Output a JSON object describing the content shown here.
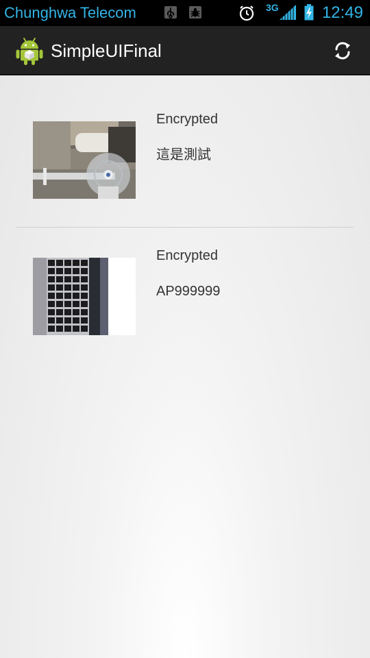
{
  "status_bar": {
    "carrier": "Chunghwa Telecom",
    "network_type": "3G",
    "time": "12:49",
    "icons": [
      "usb-icon",
      "bug-icon",
      "alarm-icon",
      "signal-icon",
      "battery-charging-icon"
    ]
  },
  "action_bar": {
    "title": "SimpleUIFinal",
    "app_icon": "android-icon",
    "refresh_icon": "refresh-icon"
  },
  "list": {
    "items": [
      {
        "status": "Encrypted",
        "text": "這是測試",
        "thumbnail": "photo-fan-room"
      },
      {
        "status": "Encrypted",
        "text": "AP999999",
        "thumbnail": "photo-laptop-keyboard"
      }
    ]
  },
  "colors": {
    "status_bar_text": "#33b5e5",
    "action_bar_bg": "#222222",
    "list_text": "#333333"
  }
}
